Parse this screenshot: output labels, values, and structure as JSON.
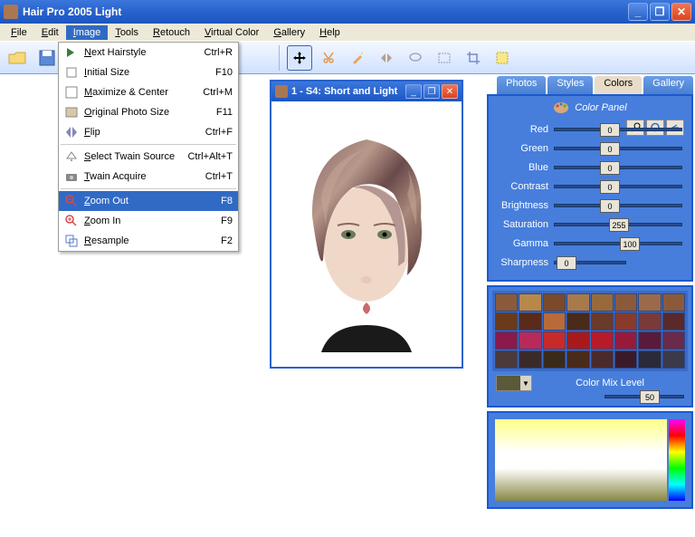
{
  "window": {
    "title": "Hair Pro 2005  Light"
  },
  "menu": [
    "File",
    "Edit",
    "Image",
    "Tools",
    "Retouch",
    "Virtual Color",
    "Gallery",
    "Help"
  ],
  "menu_open_index": 2,
  "dropdown": [
    {
      "icon": "next",
      "label": "Next Hairstyle",
      "shortcut": "Ctrl+R"
    },
    {
      "icon": "initial",
      "label": "Initial Size",
      "shortcut": "F10"
    },
    {
      "icon": "maximize",
      "label": "Maximize & Center",
      "shortcut": "Ctrl+M"
    },
    {
      "icon": "original",
      "label": "Original Photo Size",
      "shortcut": "F11"
    },
    {
      "icon": "flip",
      "label": "Flip",
      "shortcut": "Ctrl+F"
    },
    {
      "sep": true
    },
    {
      "icon": "twain-src",
      "label": "Select Twain Source",
      "shortcut": "Ctrl+Alt+T"
    },
    {
      "icon": "twain-acq",
      "label": "Twain Acquire",
      "shortcut": "Ctrl+T"
    },
    {
      "sep": true
    },
    {
      "icon": "zoom-out",
      "label": "Zoom Out",
      "shortcut": "F8",
      "hov": true
    },
    {
      "icon": "zoom-in",
      "label": "Zoom In",
      "shortcut": "F9"
    },
    {
      "icon": "resample",
      "label": "Resample",
      "shortcut": "F2"
    }
  ],
  "child_window": {
    "title": "1 - S4: Short and Light"
  },
  "tabs": [
    "Photos",
    "Styles",
    "Colors",
    "Gallery"
  ],
  "active_tab": 2,
  "color_panel": {
    "title": "Color Panel",
    "sliders": [
      {
        "name": "Red",
        "value": 0,
        "pos": 50
      },
      {
        "name": "Green",
        "value": 0,
        "pos": 50
      },
      {
        "name": "Blue",
        "value": 0,
        "pos": 50
      },
      {
        "name": "Contrast",
        "value": 0,
        "pos": 50
      },
      {
        "name": "Brightness",
        "value": 0,
        "pos": 50
      },
      {
        "name": "Saturation",
        "value": 255,
        "pos": 60
      },
      {
        "name": "Gamma",
        "value": 100,
        "pos": 72
      },
      {
        "name": "Sharpness",
        "value": 0,
        "pos": 0
      }
    ],
    "swatches": [
      "#8a5a3a",
      "#b8874a",
      "#7a4a2a",
      "#a87a4a",
      "#986a3a",
      "#8a5a3a",
      "#9a6a4a",
      "#8a5a3a",
      "#6a3a1a",
      "#5a2a1a",
      "#b86a3a",
      "#4a2a1a",
      "#6a3a2a",
      "#8a3a2a",
      "#7a3a3a",
      "#5a2a2a",
      "#8a1a4a",
      "#b82a5a",
      "#c82a2a",
      "#a81a1a",
      "#b81a2a",
      "#981a3a",
      "#5a1a3a",
      "#6a2a4a",
      "#4a3a3a",
      "#3a2a2a",
      "#3a2a1a",
      "#4a2a1a",
      "#4a2a2a",
      "#3a1a2a",
      "#2a2a3a",
      "#3a3a4a"
    ],
    "mix_label": "Color Mix Level",
    "mix_value": 50
  }
}
